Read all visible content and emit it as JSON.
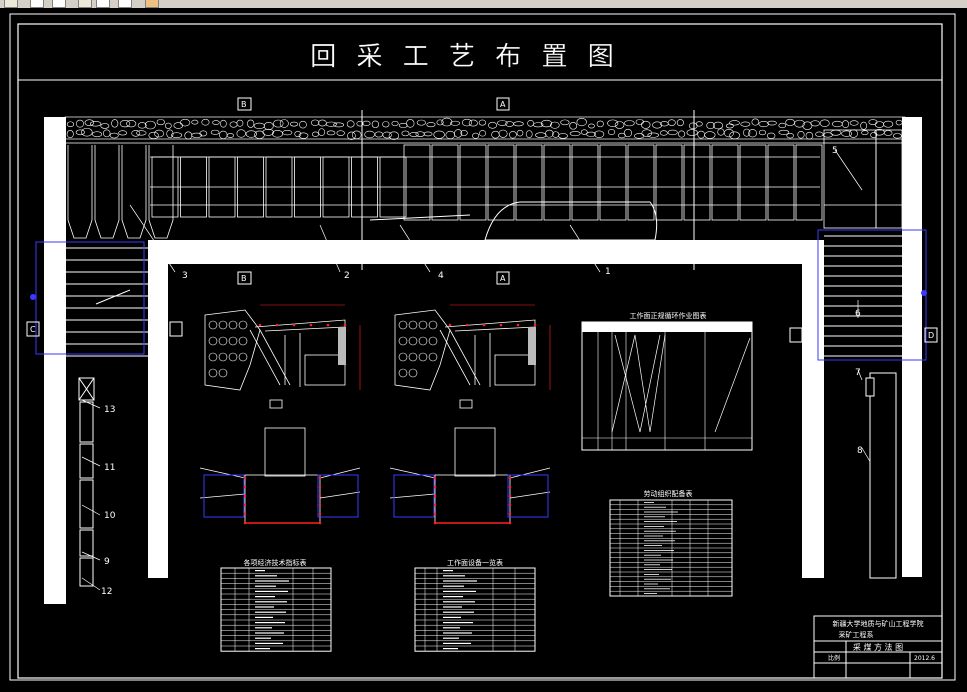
{
  "window": {
    "toolbar_icons": [
      "select-arrow-icon",
      "new-icon",
      "open-icon",
      "save-icon",
      "edit-icon",
      "cursor-icon",
      "paint-icon"
    ]
  },
  "drawing": {
    "title": "回 采 工 艺 布 置 图",
    "section_labels": {
      "top_left": "B",
      "top_mid": "A",
      "bottom_left": "B",
      "bottom_mid": "A",
      "left_side": "C",
      "right_side": "D"
    },
    "callouts": [
      "1",
      "2",
      "3",
      "4",
      "5",
      "6",
      "7",
      "8",
      "9",
      "10",
      "11",
      "12",
      "13"
    ],
    "tables": {
      "process_schedule": "工作面正规循环作业图表",
      "labor_table": "劳动组织配备表",
      "tech_table": "各项经济技术指标表",
      "equipment_table": "工作面设备一览表"
    },
    "title_block": {
      "line1": "新疆大学地质与矿山工程学院",
      "line2": "采矿工程系",
      "drawing_name": "采 煤 方 法 图",
      "small_1": "比例",
      "small_2": "2012.6"
    }
  },
  "colors": {
    "lines": "#ffffff",
    "accent_red": "#ff2020",
    "accent_blue": "#3a3aff",
    "background": "#000000"
  }
}
